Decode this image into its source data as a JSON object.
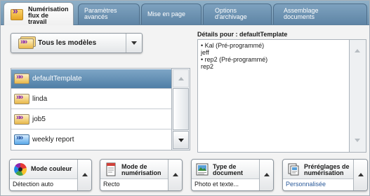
{
  "tabs": [
    {
      "label": "Numérisation\nflux de travail",
      "active": true
    },
    {
      "label": "Paramètres\navancés",
      "active": false
    },
    {
      "label": "Mise en page",
      "active": false
    },
    {
      "label": "Options\nd'archivage",
      "active": false
    },
    {
      "label": "Assemblage\ndocuments",
      "active": false
    }
  ],
  "template_filter": {
    "selected": "Tous les modèles",
    "icon": "template-stack-icon"
  },
  "templates": [
    {
      "name": "defaultTemplate",
      "selected": true,
      "icon": "template-icon"
    },
    {
      "name": "linda",
      "selected": false,
      "icon": "template-icon"
    },
    {
      "name": "job5",
      "selected": false,
      "icon": "template-icon"
    },
    {
      "name": "weekly report",
      "selected": false,
      "icon": "template-blue-icon"
    }
  ],
  "details": {
    "title": "Détails pour : defaultTemplate",
    "lines": [
      "• Kal (Pré-programmé)",
      "jeff",
      "• rep2 (Pré-programmé)",
      "rep2"
    ]
  },
  "features": [
    {
      "title": "Mode couleur",
      "value": "Détection auto",
      "icon": "color-wheel-icon",
      "value_highlight": false
    },
    {
      "title": "Mode de\nnumérisation",
      "value": "Recto",
      "icon": "single-page-icon",
      "value_highlight": false
    },
    {
      "title": "Type de\ndocument",
      "value": "Photo et texte...",
      "icon": "photo-document-icon",
      "value_highlight": false
    },
    {
      "title": "Préréglages de\nnumérisation",
      "value": "Personnalisée",
      "icon": "scan-presets-icon",
      "value_highlight": true
    }
  ],
  "colors": {
    "tab_bar": "#6f93b0",
    "selected_row": "#4f7ea6",
    "highlight_text": "#2a5a9a"
  }
}
